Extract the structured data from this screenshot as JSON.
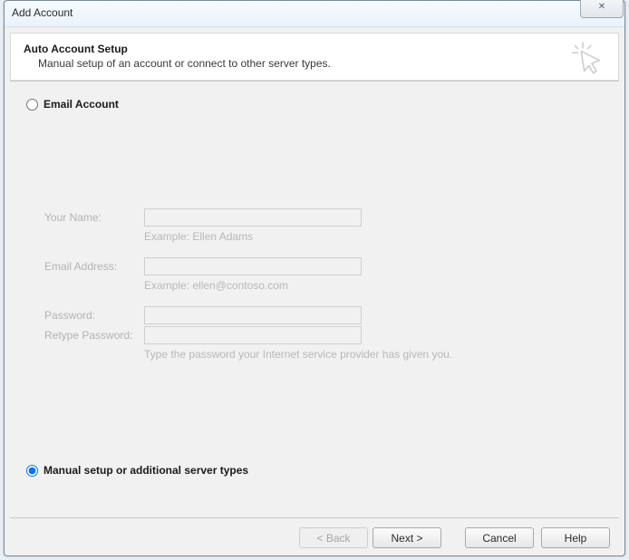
{
  "window": {
    "title": "Add Account",
    "close_glyph": "✕"
  },
  "header": {
    "title": "Auto Account Setup",
    "subtitle": "Manual setup of an account or connect to other server types."
  },
  "options": {
    "email_label": "Email Account",
    "manual_label": "Manual setup or additional server types",
    "selected": "manual"
  },
  "form": {
    "name_label": "Your Name:",
    "name_hint": "Example: Ellen Adams",
    "email_label": "Email Address:",
    "email_hint": "Example: ellen@contoso.com",
    "password_label": "Password:",
    "retype_label": "Retype Password:",
    "password_hint": "Type the password your Internet service provider has given you."
  },
  "buttons": {
    "back": "< Back",
    "next": "Next >",
    "cancel": "Cancel",
    "help": "Help"
  }
}
